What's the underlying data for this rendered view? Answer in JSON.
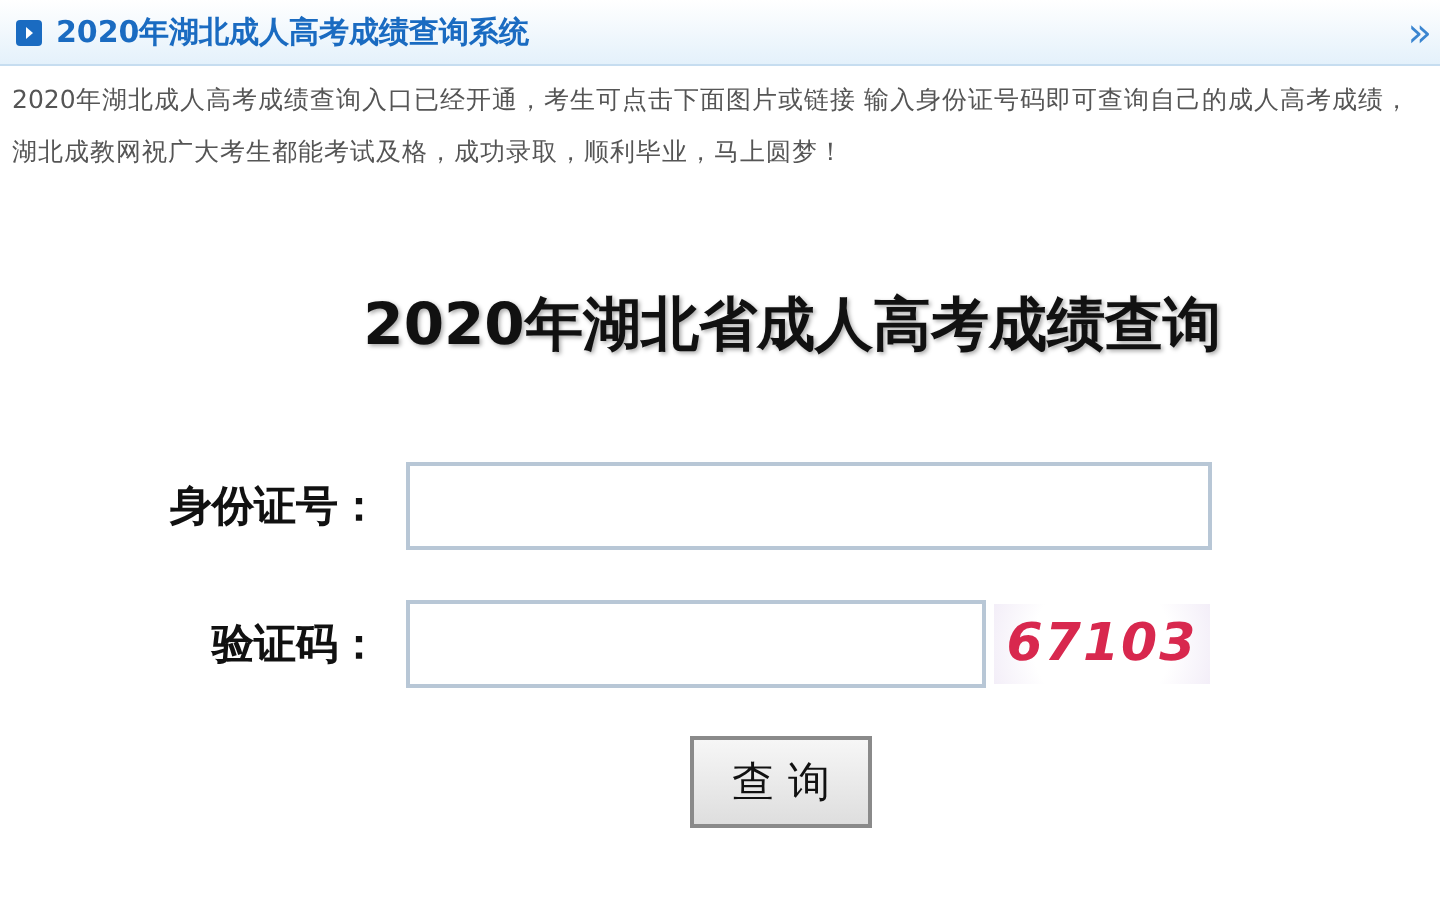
{
  "header": {
    "title": "2020年湖北成人高考成绩查询系统",
    "more": "»"
  },
  "intro": "2020年湖北成人高考成绩查询入口已经开通，考生可点击下面图片或链接 输入身份证号码即可查询自己的成人高考成绩，湖北成教网祝广大考生都能考试及格，成功录取，顺利毕业，马上圆梦！",
  "form": {
    "title": "2020年湖北省成人高考成绩查询",
    "fields": [
      {
        "kind": "text",
        "label": "身份证号："
      },
      {
        "kind": "captcha",
        "label": "验证码：",
        "captcha": "67103"
      }
    ],
    "submit": "查 询"
  }
}
